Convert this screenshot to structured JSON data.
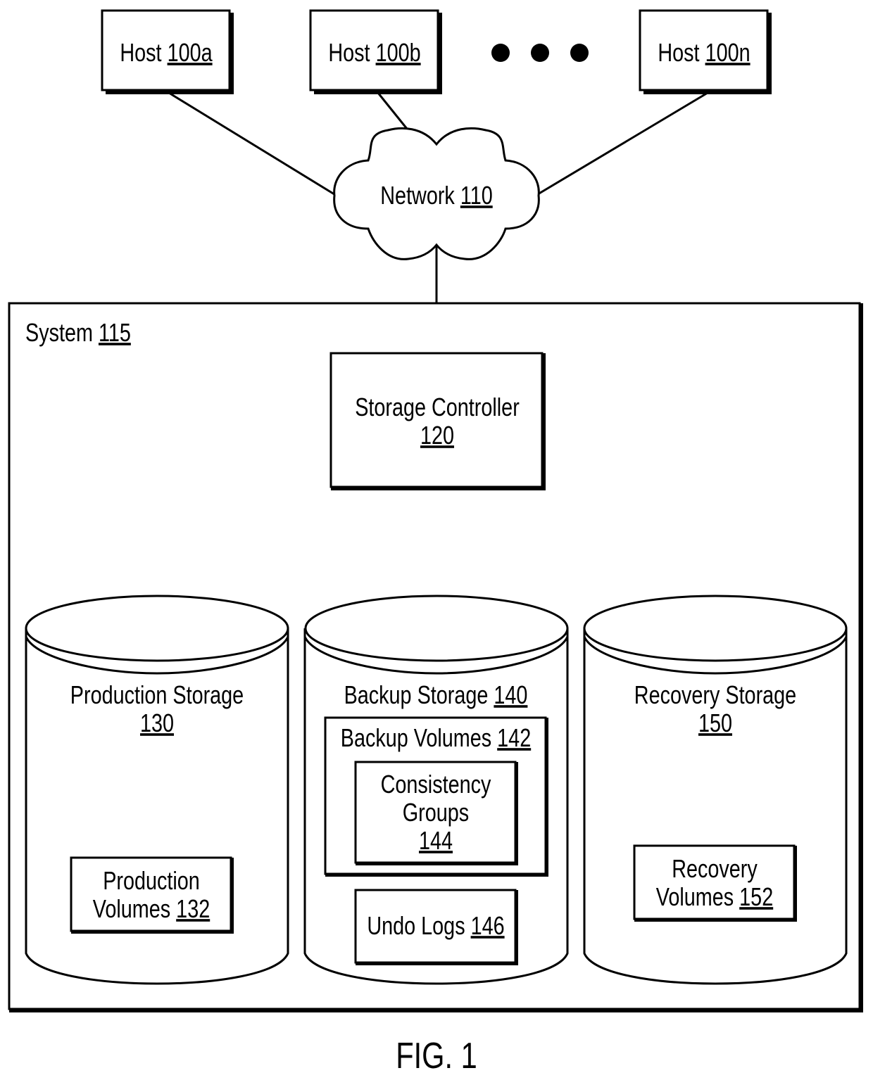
{
  "figure": {
    "caption": "FIG. 1",
    "colors": {
      "line": "#000000",
      "background": "#ffffff"
    }
  },
  "hosts": [
    {
      "name": "Host",
      "ref": "100a"
    },
    {
      "name": "Host",
      "ref": "100b"
    },
    {
      "name": "Host",
      "ref": "100n"
    }
  ],
  "ellipsis": "• • •",
  "network": {
    "name": "Network",
    "ref": "110",
    "shape": "cloud"
  },
  "system": {
    "name": "System",
    "ref": "115",
    "controller": {
      "name": "Storage Controller",
      "ref": "120"
    },
    "storages": [
      {
        "name": "Production Storage",
        "ref": "130",
        "shape": "cylinder",
        "items": [
          {
            "line1": "Production",
            "line2": "Volumes",
            "ref": "132"
          }
        ]
      },
      {
        "name": "Backup Storage",
        "ref": "140",
        "shape": "cylinder",
        "group": {
          "name": "Backup Volumes",
          "ref": "142",
          "child": {
            "line1": "Consistency",
            "line2": "Groups",
            "ref": "144"
          }
        },
        "items": [
          {
            "name": "Undo Logs",
            "ref": "146"
          }
        ]
      },
      {
        "name": "Recovery Storage",
        "ref": "150",
        "shape": "cylinder",
        "items": [
          {
            "line1": "Recovery",
            "line2": "Volumes",
            "ref": "152"
          }
        ]
      }
    ]
  },
  "connections": [
    {
      "from": "Host 100a",
      "to": "Network 110"
    },
    {
      "from": "Host 100b",
      "to": "Network 110"
    },
    {
      "from": "Host 100n",
      "to": "Network 110"
    },
    {
      "from": "Network 110",
      "to": "System 115"
    },
    {
      "from": "Storage Controller 120",
      "to": "Production Storage 130"
    },
    {
      "from": "Storage Controller 120",
      "to": "Backup Storage 140"
    },
    {
      "from": "Storage Controller 120",
      "to": "Recovery Storage 150"
    }
  ]
}
